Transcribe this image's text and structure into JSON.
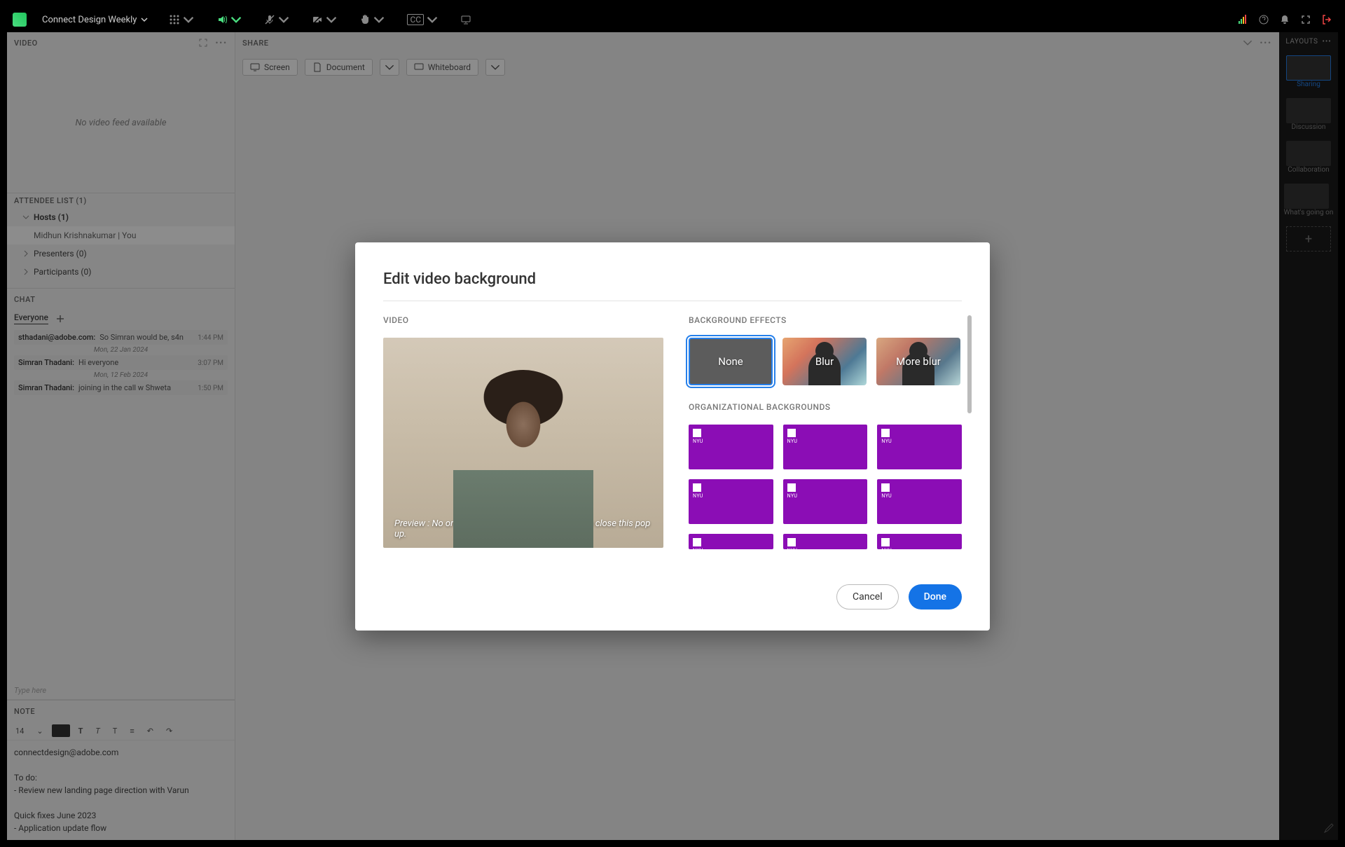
{
  "topbar": {
    "meeting_name": "Connect Design Weekly",
    "cc_label": "CC",
    "exit_icon": "sign-out"
  },
  "video_pod": {
    "header": "VIDEO",
    "empty_text": "No video feed available"
  },
  "attendee_pod": {
    "header": "ATTENDEE LIST   (1)",
    "hosts_label": "Hosts (1)",
    "host_entry": "Midhun Krishnakumar  | You",
    "presenters_label": "Presenters (0)",
    "participants_label": "Participants (0)"
  },
  "chat_pod": {
    "header": "CHAT",
    "tab_everyone": "Everyone",
    "date1": "Mon, 22 Jan 2024",
    "date2": "Mon, 12 Feb 2024",
    "msg1_who": "sthadani@adobe.com:",
    "msg1_text": "So Simran would be, s4n",
    "msg1_time": "1:44 PM",
    "msg2_who": "Simran Thadani:",
    "msg2_text": "Hi everyone",
    "msg2_time": "3:07 PM",
    "msg3_who": "Simran Thadani:",
    "msg3_text": "joining in the call w Shweta",
    "msg3_time": "1:50 PM",
    "input_placeholder": "Type here"
  },
  "note_pod": {
    "header": "NOTE",
    "font_size": "14",
    "body_line1": "connectdesign@adobe.com",
    "body_line2": "To do:",
    "body_line3": "- Review new landing page direction with Varun",
    "body_line4": "Quick fixes June 2023",
    "body_line5": "- Application update flow"
  },
  "share_pod": {
    "header": "SHARE",
    "btn_screen": "Screen",
    "btn_document": "Document",
    "btn_whiteboard": "Whiteboard"
  },
  "layouts": {
    "header": "LAYOUTS",
    "items": [
      "Sharing",
      "Discussion",
      "Collaboration",
      "What's going on"
    ]
  },
  "modal": {
    "title": "Edit video background",
    "video_label": "VIDEO",
    "preview_caption": "Preview : No one can see you background until you close this pop up.",
    "bg_effects_label": "BACKGROUND EFFECTS",
    "fx_none": "None",
    "fx_blur": "Blur",
    "fx_more_blur": "More blur",
    "org_label": "ORGANIZATIONAL BACKGROUNDS",
    "cancel": "Cancel",
    "done": "Done"
  }
}
